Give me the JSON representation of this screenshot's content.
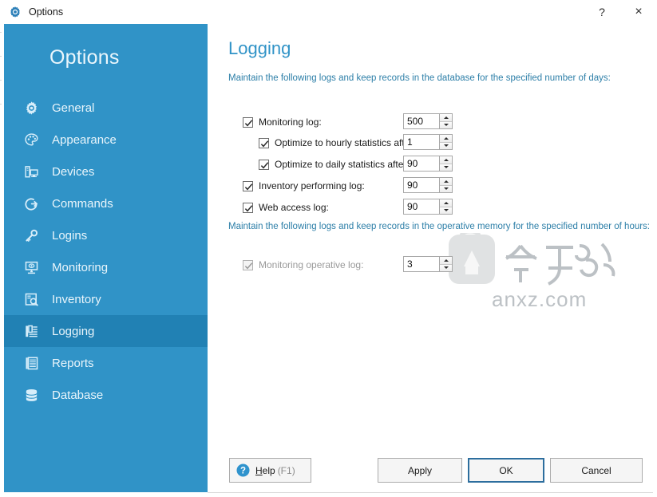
{
  "window": {
    "title": "Options",
    "app_icon": "gear-icon",
    "help_button": "?",
    "close_button": "×"
  },
  "sidebar": {
    "heading": "Options",
    "accent": "#3093c7",
    "active_accent": "#2181b4",
    "items": [
      {
        "label": "General",
        "icon": "gear-icon",
        "active": false
      },
      {
        "label": "Appearance",
        "icon": "palette-icon",
        "active": false
      },
      {
        "label": "Devices",
        "icon": "devices-icon",
        "active": false
      },
      {
        "label": "Commands",
        "icon": "command-icon",
        "active": false
      },
      {
        "label": "Logins",
        "icon": "key-icon",
        "active": false
      },
      {
        "label": "Monitoring",
        "icon": "monitor-icon",
        "active": false
      },
      {
        "label": "Inventory",
        "icon": "inventory-icon",
        "active": false
      },
      {
        "label": "Logging",
        "icon": "log-icon",
        "active": true
      },
      {
        "label": "Reports",
        "icon": "report-icon",
        "active": false
      },
      {
        "label": "Database",
        "icon": "database-icon",
        "active": false
      }
    ]
  },
  "main": {
    "title": "Logging",
    "title_color": "#3093c7",
    "section1": {
      "note": "Maintain the following logs and keep records in the database for the specified number of days:",
      "rows": [
        {
          "label": "Monitoring log:",
          "checked": true,
          "value": "500",
          "indent": false,
          "disabled": false
        },
        {
          "label": "Optimize to hourly statistics after:",
          "checked": true,
          "value": "1",
          "indent": true,
          "disabled": false
        },
        {
          "label": "Optimize to daily statistics after:",
          "checked": true,
          "value": "90",
          "indent": true,
          "disabled": false
        },
        {
          "label": "Inventory performing log:",
          "checked": true,
          "value": "90",
          "indent": false,
          "disabled": false
        },
        {
          "label": "Web access log:",
          "checked": true,
          "value": "90",
          "indent": false,
          "disabled": false
        }
      ]
    },
    "section2": {
      "note": "Maintain the following logs and keep records in the operative memory for the specified number of hours:",
      "rows": [
        {
          "label": "Monitoring operative log:",
          "checked": true,
          "value": "3",
          "indent": false,
          "disabled": true
        }
      ]
    },
    "watermark": {
      "text_cn": "安下载",
      "text_badge": "安",
      "text_url": "anxz.com"
    }
  },
  "footer": {
    "help": {
      "accel": "H",
      "rest": "elp",
      "hint": "(F1)",
      "icon": "question-mark-icon"
    },
    "apply": "Apply",
    "ok": "OK",
    "cancel": "Cancel"
  }
}
